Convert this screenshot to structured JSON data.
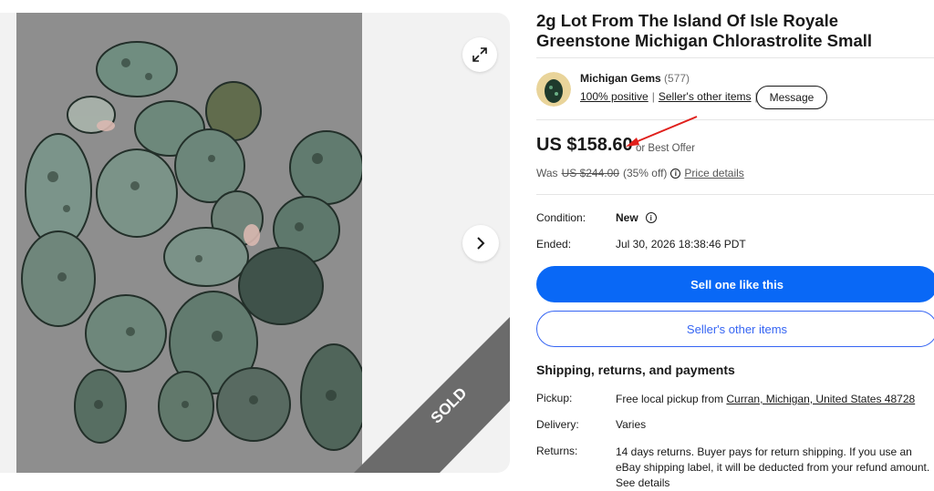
{
  "gallery": {
    "sold_badge": "SOLD"
  },
  "listing": {
    "title": "2g Lot From The Island Of Isle Royale Greenstone Michigan Chlorastrolite Small"
  },
  "seller": {
    "name": "Michigan Gems",
    "feedback_count": "(577)",
    "positive": "100% positive",
    "other_items": "Seller's other items",
    "message_label": "Message"
  },
  "price": {
    "current": "US $158.60",
    "best_offer": "or Best Offer",
    "was_label": "Was",
    "was_value": "US $244.00",
    "discount": "(35% off)",
    "details_link": "Price details"
  },
  "details": {
    "condition_label": "Condition:",
    "condition_value": "New",
    "ended_label": "Ended:",
    "ended_value": "Jul 30, 2026 18:38:46 PDT"
  },
  "actions": {
    "sell_one_like_this": "Sell one like this",
    "sellers_other_items": "Seller's other items"
  },
  "shipping": {
    "heading": "Shipping, returns, and payments",
    "pickup_label": "Pickup:",
    "pickup_prefix": "Free local pickup from",
    "pickup_location": "Curran, Michigan, United States 48728",
    "delivery_label": "Delivery:",
    "delivery_value": "Varies",
    "returns_label": "Returns:",
    "returns_value": "14 days returns. Buyer pays for return shipping. If you use an eBay shipping label, it will be deducted from your refund amount.",
    "returns_more": "See details"
  },
  "colors": {
    "primary_blue": "#0968f6",
    "annotation_red": "#e0201c",
    "sold_ribbon": "#6b6b6b"
  }
}
